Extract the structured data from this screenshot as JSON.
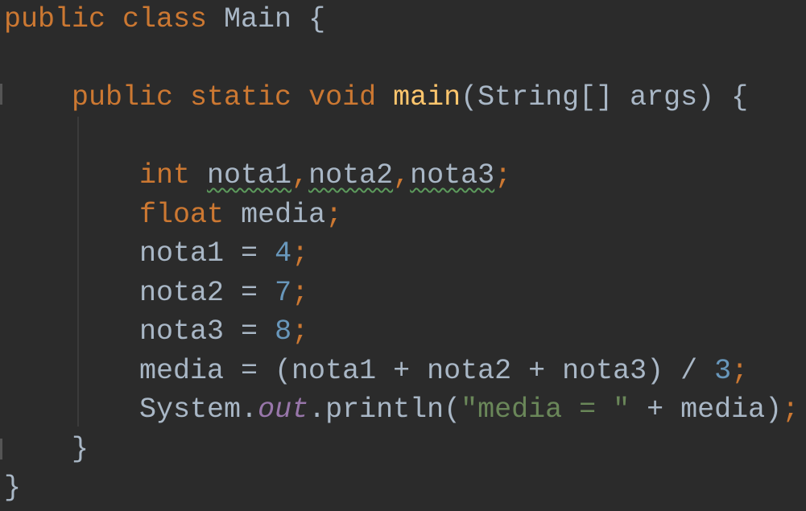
{
  "colors": {
    "background": "#2b2b2b",
    "keyword": "#cc7832",
    "identifier": "#a9b7c6",
    "number": "#6897bb",
    "string": "#6a8759",
    "field": "#9876aa",
    "method": "#ffc66d"
  },
  "lines": [
    [
      [
        "kw",
        "public class "
      ],
      [
        "id",
        "Main {"
      ]
    ],
    [],
    [
      [
        "id",
        "    "
      ],
      [
        "kw",
        "public static void "
      ],
      [
        "fn",
        "main"
      ],
      [
        "id",
        "(String[] args) {"
      ]
    ],
    [],
    [
      [
        "id",
        "        "
      ],
      [
        "kw",
        "int "
      ],
      [
        "warn",
        "nota1"
      ],
      [
        "kw",
        ","
      ],
      [
        "warn",
        "nota2"
      ],
      [
        "kw",
        ","
      ],
      [
        "warn",
        "nota3"
      ],
      [
        "kw",
        ";"
      ]
    ],
    [
      [
        "id",
        "        "
      ],
      [
        "kw",
        "float "
      ],
      [
        "id",
        "media"
      ],
      [
        "kw",
        ";"
      ]
    ],
    [
      [
        "id",
        "        nota1 = "
      ],
      [
        "num",
        "4"
      ],
      [
        "kw",
        ";"
      ]
    ],
    [
      [
        "id",
        "        nota2 = "
      ],
      [
        "num",
        "7"
      ],
      [
        "kw",
        ";"
      ]
    ],
    [
      [
        "id",
        "        nota3 = "
      ],
      [
        "num",
        "8"
      ],
      [
        "kw",
        ";"
      ]
    ],
    [
      [
        "id",
        "        media = (nota1 + nota2 + nota3) / "
      ],
      [
        "num",
        "3"
      ],
      [
        "kw",
        ";"
      ]
    ],
    [
      [
        "id",
        "        System."
      ],
      [
        "field",
        "out"
      ],
      [
        "id",
        ".println("
      ],
      [
        "str",
        "\"media = \""
      ],
      [
        "id",
        " + media)"
      ],
      [
        "kw",
        ";"
      ]
    ],
    [
      [
        "id",
        "    }"
      ]
    ],
    [
      [
        "id",
        "}"
      ]
    ]
  ]
}
